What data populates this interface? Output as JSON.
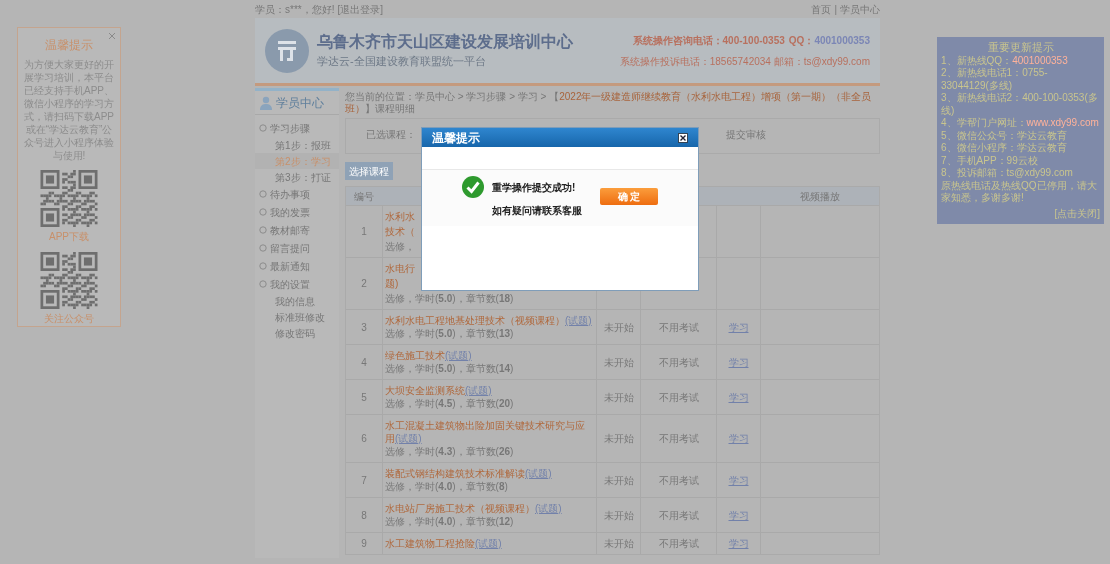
{
  "top_bar": {
    "greeting": "学员：s***，您好!",
    "logout": "[退出登录]",
    "separator": "|",
    "links": [
      "首页",
      "学员中心"
    ]
  },
  "header": {
    "title": "乌鲁木齐市天山区建设发展培训中心",
    "subtitle": "学达云-全国建设教育联盟统一平台",
    "hotline_label": "系统操作咨询电话：400-100-0353",
    "qq_label": "QQ：",
    "qq": "4001000353",
    "complaint": "系统操作投诉电话：18565742034  邮箱：ts@xdy99.com"
  },
  "left_notice": {
    "title": "温馨提示",
    "text": "为方便大家更好的开展学习培训，本平台已经支持手机APP、微信小程序的学习方式，请扫码下载APP或在“学达云教育”公众号进入小程序体验与使用!",
    "captions": [
      "APP下载",
      "关注公众号"
    ]
  },
  "sidebar": {
    "title": "学员中心",
    "groups": [
      {
        "label": "学习步骤",
        "children": [
          {
            "label": "第1步：报班",
            "selected": false
          },
          {
            "label": "第2步：学习",
            "selected": true
          },
          {
            "label": "第3步：打证",
            "selected": false
          }
        ]
      },
      {
        "label": "待办事项"
      },
      {
        "label": "我的发票"
      },
      {
        "label": "教材邮寄"
      },
      {
        "label": "留言提问"
      },
      {
        "label": "最新通知"
      },
      {
        "label": "我的设置",
        "children": [
          {
            "label": "我的信息",
            "selected": false
          },
          {
            "label": "标准班修改",
            "selected": false
          },
          {
            "label": "修改密码",
            "selected": false
          }
        ]
      }
    ]
  },
  "breadcrumb": {
    "prefix": "您当前的位置：学员中心 > 学习步骤 > 学习 > 【",
    "course": "2022年一级建造师继续教育（水利水电工程）增项（第一期）（非全员班）",
    "suffix": "】课程明细"
  },
  "selected_box": {
    "label": "已选课程：",
    "status": "提交审核"
  },
  "action_button": "选择课程",
  "table": {
    "header": {
      "number": "编号",
      "column_6": "视频播放"
    },
    "rows": [
      {
        "kind": "partial",
        "number": "1",
        "lines": [
          "水利水",
          "技术（",
          "选修，"
        ]
      },
      {
        "kind": "partial",
        "number": "2",
        "lines": [
          "水电行",
          "题)",
          "选修，学时(**5.0**)，章节数(**18**)"
        ]
      },
      {
        "kind": "full",
        "number": "3",
        "title": "水利水电工程地基处理技术（视频课程）",
        "link": "(试题)",
        "meta": "选修，学时(**5.0**)，章节数(**13**)",
        "status": "未开始",
        "exam": "不用考试",
        "action": "学习"
      },
      {
        "kind": "full",
        "number": "4",
        "title": "绿色施工技术",
        "link": "(试题)",
        "meta": "选修，学时(**5.0**)，章节数(**14**)",
        "status": "未开始",
        "exam": "不用考试",
        "action": "学习"
      },
      {
        "kind": "full",
        "number": "5",
        "title": "大坝安全监测系统",
        "link": "(试题)",
        "meta": "选修，学时(**4.5**)，章节数(**20**)",
        "status": "未开始",
        "exam": "不用考试",
        "action": "学习"
      },
      {
        "kind": "full",
        "number": "6",
        "title": "水工混凝土建筑物出险加固关键技术研究与应用",
        "link": "(试题)",
        "meta": "选修，学时(**4.3**)，章节数(**26**)",
        "status": "未开始",
        "exam": "不用考试",
        "action": "学习"
      },
      {
        "kind": "full",
        "number": "7",
        "title": "装配式钢结构建筑技术标准解读",
        "link": "(试题)",
        "meta": "选修，学时(**4.0**)，章节数(**8**)",
        "status": "未开始",
        "exam": "不用考试",
        "action": "学习"
      },
      {
        "kind": "full",
        "number": "8",
        "title": "水电站厂房施工技术（视频课程）",
        "link": "(试题)",
        "meta": "选修，学时(**4.0**)，章节数(**12**)",
        "status": "未开始",
        "exam": "不用考试",
        "action": "学习"
      },
      {
        "kind": "full",
        "number": "9",
        "title": "水工建筑物工程抢险",
        "link": "(试题)",
        "status": "未开始",
        "exam": "不用考试",
        "action": "学习"
      }
    ]
  },
  "right_notice": {
    "title": "重要更新提示",
    "items": [
      {
        "label": "1、新热线QQ：",
        "value": "4001000353",
        "highlight": true
      },
      {
        "label": "2、新热线电话1：",
        "value": "0755-33044129(多线)",
        "highlight": false
      },
      {
        "label": "3、新热线电话2：",
        "value": "400-100-0353(多线)",
        "highlight": false
      },
      {
        "label": "4、学帮门户网址：",
        "value": "www.xdy99.com",
        "highlight": true
      },
      {
        "label": "5、微信公众号：",
        "value": "学达云教育",
        "highlight": false
      },
      {
        "label": "6、微信小程序：",
        "value": "学达云教育",
        "highlight": false
      },
      {
        "label": "7、手机APP：",
        "value": "99云校",
        "highlight": false
      },
      {
        "label": "8、投诉邮箱：",
        "value": "ts@xdy99.com",
        "highlight": false
      }
    ],
    "note": "原热线电话及热线QQ已停用，请大家知悉，多谢多谢!",
    "close": "[点击关闭]"
  },
  "dialog": {
    "title": "温馨提示",
    "message": "重学操作提交成功!",
    "hint": "如有疑问请联系客服",
    "button": "确 定"
  }
}
